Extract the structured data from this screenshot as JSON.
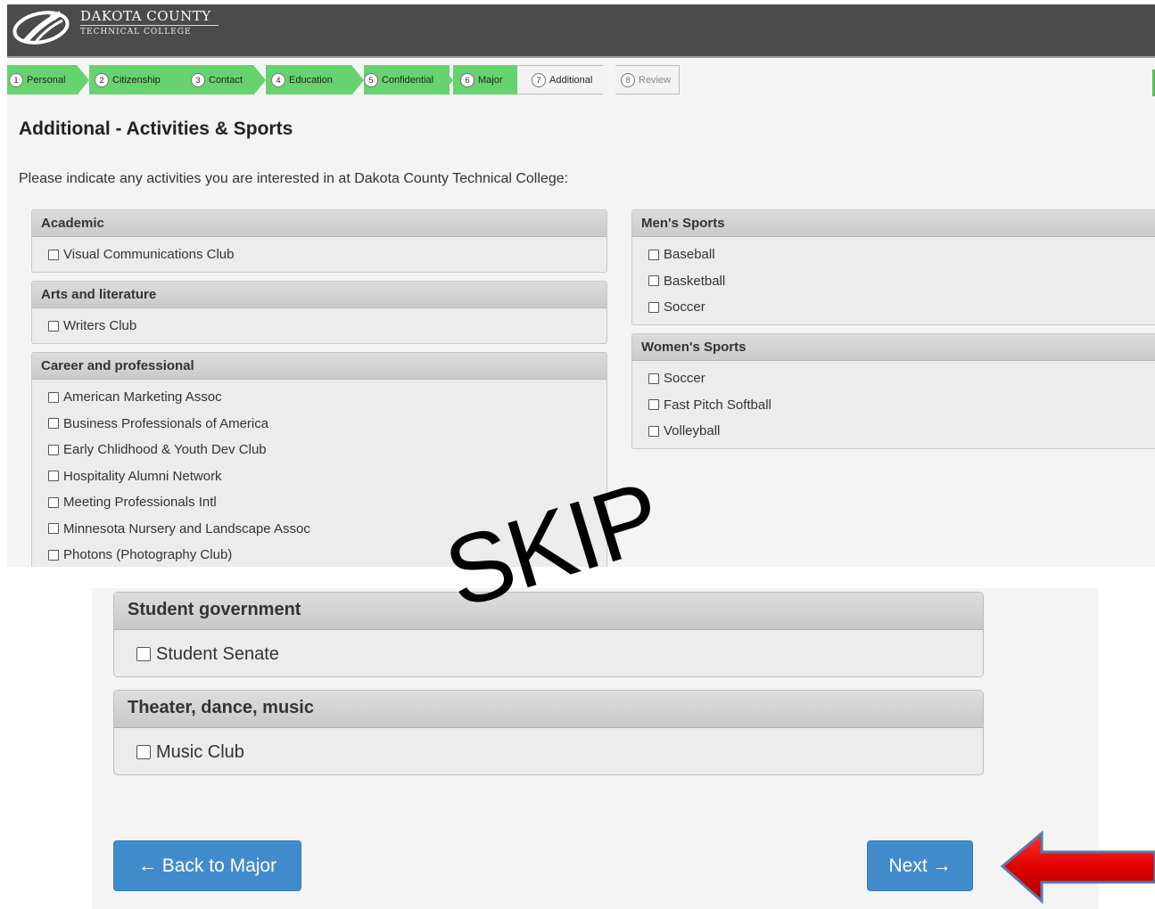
{
  "header": {
    "brand_name": "DAKOTA COUNTY",
    "brand_sub": "TECHNICAL COLLEGE"
  },
  "steps": [
    {
      "num": "1",
      "label": "Personal",
      "state": "done"
    },
    {
      "num": "2",
      "label": "Citizenship",
      "state": "done"
    },
    {
      "num": "3",
      "label": "Contact",
      "state": "done"
    },
    {
      "num": "4",
      "label": "Education",
      "state": "done"
    },
    {
      "num": "5",
      "label": "Confidential",
      "state": "done"
    },
    {
      "num": "6",
      "label": "Major",
      "state": "done"
    },
    {
      "num": "7",
      "label": "Additional",
      "state": "current"
    },
    {
      "num": "8",
      "label": "Review",
      "state": "future"
    }
  ],
  "page": {
    "title": "Additional - Activities & Sports",
    "intro": "Please indicate any activities you are interested in at Dakota County Technical College:"
  },
  "groups": {
    "academic": {
      "title": "Academic",
      "items": [
        "Visual Communications Club"
      ]
    },
    "arts": {
      "title": "Arts and literature",
      "items": [
        "Writers Club"
      ]
    },
    "career": {
      "title": "Career and professional",
      "items": [
        "American Marketing Assoc",
        "Business Professionals of America",
        "Early Chlidhood & Youth Dev Club",
        "Hospitality Alumni Network",
        "Meeting Professionals Intl",
        "Minnesota Nursery and Landscape Assoc",
        "Photons (Photography Club)"
      ]
    },
    "mens": {
      "title": "Men's Sports",
      "items": [
        "Baseball",
        "Basketball",
        "Soccer"
      ]
    },
    "womens": {
      "title": "Women's Sports",
      "items": [
        "Soccer",
        "Fast Pitch Softball",
        "Volleyball"
      ]
    },
    "student_gov": {
      "title": "Student government",
      "items": [
        "Student Senate"
      ]
    },
    "theater": {
      "title": "Theater, dance, music",
      "items": [
        "Music Club"
      ]
    }
  },
  "buttons": {
    "back": "← Back to Major",
    "next": "Next →"
  },
  "annotation": {
    "skip_text": "SKIP"
  },
  "colors": {
    "step_done": "#66d36e",
    "button": "#428bca",
    "header": "#4b4b4b",
    "arrow": "#e00000"
  }
}
